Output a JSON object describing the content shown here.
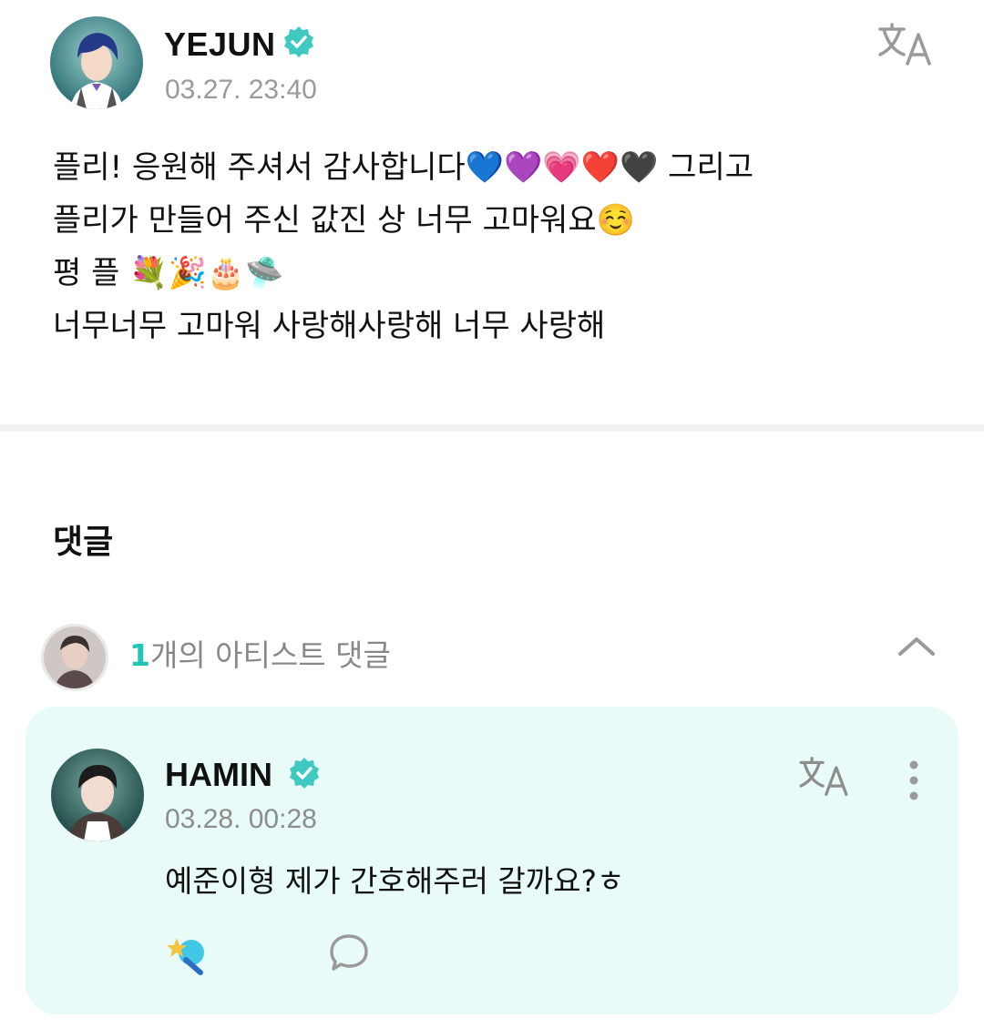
{
  "post": {
    "author_name": "YEJUN",
    "timestamp": "03.27. 23:40",
    "body_lines": [
      "플리! 응원해 주셔서 감사합니다💙💜💗❤️🖤 그리고",
      "플리가 만들어 주신 값진 상 너무 고마워요☺️",
      "평 플 💐🎉🎂🛸",
      "너무너무 고마워 사랑해사랑해 너무 사랑해"
    ]
  },
  "comments_section": {
    "heading": "댓글",
    "artist_count": "1",
    "artist_count_label": "개의 아티스트 댓글"
  },
  "comment": {
    "author_name": "HAMIN",
    "timestamp": "03.28. 00:28",
    "text": "예준이형 제가 간호해주러 갈까요?ㅎ"
  },
  "colors": {
    "accent": "#21c4b6",
    "verified_badge": "#3fc9c0",
    "comment_card_bg": "#e9fbf8",
    "timestamp": "#9a9a9a"
  },
  "icons": {
    "verified": "verified-badge-icon",
    "translate": "translate-icon",
    "collapse": "chevron-up-icon",
    "more": "more-vertical-icon",
    "cheer": "cheer-lightstick-icon",
    "reply": "speech-bubble-icon"
  }
}
